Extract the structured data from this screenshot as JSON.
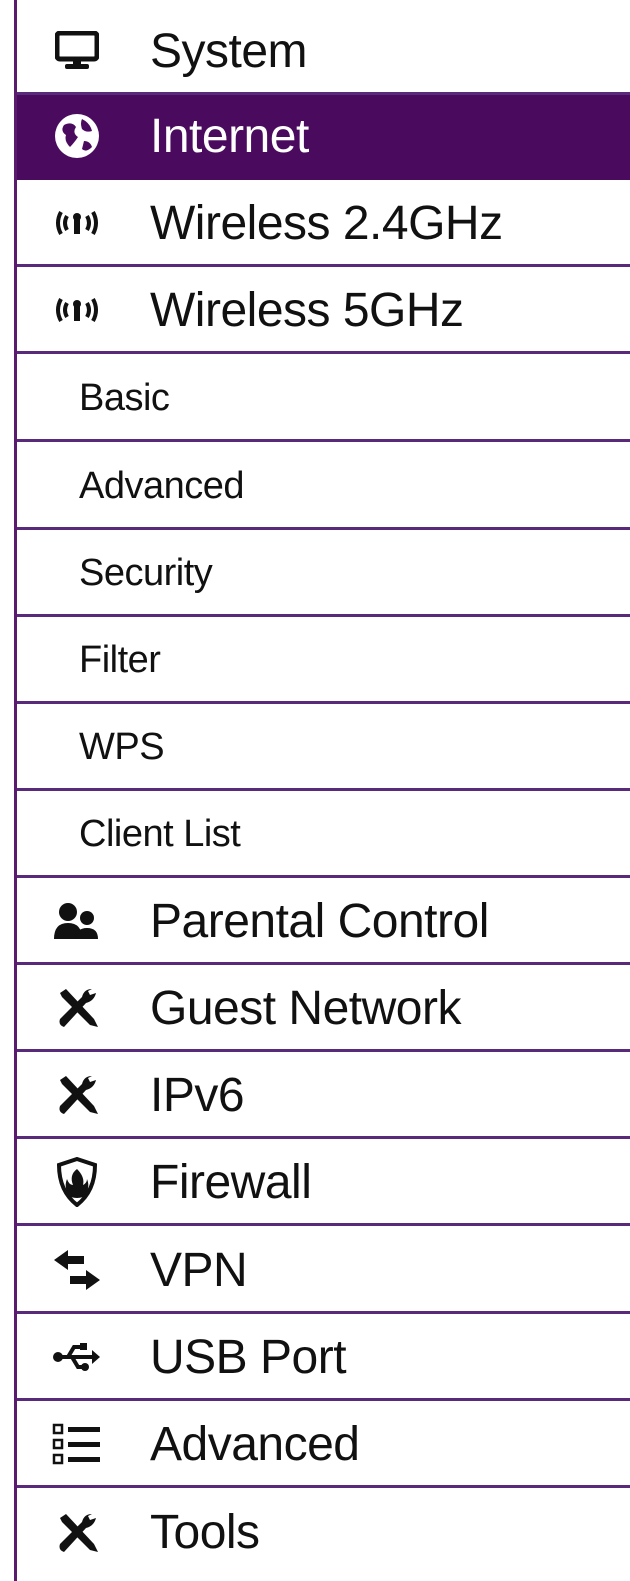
{
  "menu": {
    "items": [
      {
        "key": "system",
        "label": "System",
        "icon": "monitor-icon",
        "level": "top"
      },
      {
        "key": "internet",
        "label": "Internet",
        "icon": "globe-icon",
        "level": "top",
        "active": true
      },
      {
        "key": "wireless-24",
        "label": "Wireless 2.4GHz",
        "icon": "wireless-signal-icon",
        "level": "top"
      },
      {
        "key": "wireless-5",
        "label": "Wireless 5GHz",
        "icon": "wireless-signal-icon",
        "level": "top"
      },
      {
        "key": "basic",
        "label": "Basic",
        "level": "sub"
      },
      {
        "key": "advanced-sub",
        "label": "Advanced",
        "level": "sub"
      },
      {
        "key": "security",
        "label": "Security",
        "level": "sub"
      },
      {
        "key": "filter",
        "label": "Filter",
        "level": "sub"
      },
      {
        "key": "wps",
        "label": "WPS",
        "level": "sub"
      },
      {
        "key": "client-list",
        "label": "Client List",
        "level": "sub"
      },
      {
        "key": "parental-control",
        "label": "Parental Control",
        "icon": "users-icon",
        "level": "top"
      },
      {
        "key": "guest-network",
        "label": "Guest Network",
        "icon": "tools-icon",
        "level": "top"
      },
      {
        "key": "ipv6",
        "label": "IPv6",
        "icon": "tools-icon",
        "level": "top"
      },
      {
        "key": "firewall",
        "label": "Firewall",
        "icon": "firewall-shield-icon",
        "level": "top"
      },
      {
        "key": "vpn",
        "label": "VPN",
        "icon": "swap-arrows-icon",
        "level": "top"
      },
      {
        "key": "usb-port",
        "label": "USB Port",
        "icon": "usb-icon",
        "level": "top"
      },
      {
        "key": "advanced",
        "label": "Advanced",
        "icon": "list-icon",
        "level": "top"
      },
      {
        "key": "tools",
        "label": "Tools",
        "icon": "tools-icon",
        "level": "top"
      }
    ]
  },
  "colors": {
    "accent": "#4a0a5e",
    "divider": "#5a2a7a",
    "text": "#111111",
    "active_text": "#ffffff"
  }
}
